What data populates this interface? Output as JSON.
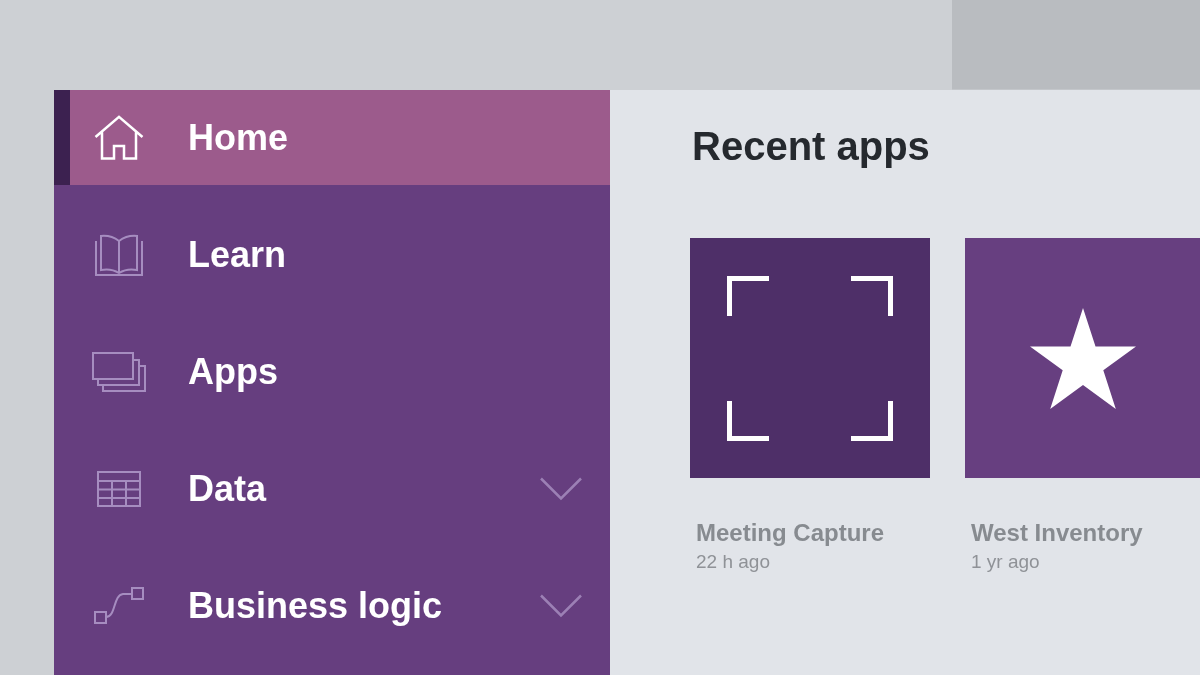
{
  "sidebar": {
    "items": [
      {
        "label": "Home",
        "selected": true,
        "kind": "link"
      },
      {
        "label": "Learn",
        "selected": false,
        "kind": "link"
      },
      {
        "label": "Apps",
        "selected": false,
        "kind": "link"
      },
      {
        "label": "Data",
        "selected": false,
        "kind": "group",
        "expanded": false
      },
      {
        "label": "Business logic",
        "selected": false,
        "kind": "group",
        "expanded": false
      }
    ]
  },
  "recent_apps": {
    "title": "Recent apps",
    "items": [
      {
        "name": "Meeting Capture",
        "time": "22 h ago",
        "color": "#4e2f68"
      },
      {
        "name": "West Inventory",
        "time": "1 yr ago",
        "color": "#673f80"
      }
    ]
  }
}
